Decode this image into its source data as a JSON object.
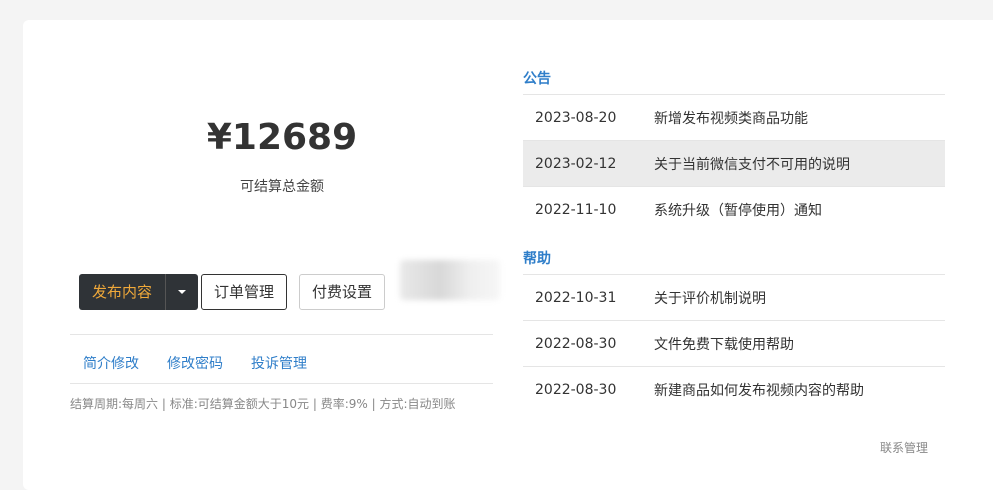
{
  "summary": {
    "amount": "¥12689",
    "amount_label": "可结算总金额"
  },
  "actions": {
    "publish_label": "发布内容",
    "orders_label": "订单管理",
    "pay_settings_label": "付费设置"
  },
  "links": [
    "简介修改",
    "修改密码",
    "投诉管理"
  ],
  "footnote": "结算周期:每周六 | 标准:可结算金额大于10元 | 费率:9% | 方式:自动到账",
  "announcements": {
    "title": "公告",
    "items": [
      {
        "date": "2023-08-20",
        "text": "新增发布视频类商品功能"
      },
      {
        "date": "2023-02-12",
        "text": "关于当前微信支付不可用的说明"
      },
      {
        "date": "2022-11-10",
        "text": "系统升级（暂停使用）通知"
      }
    ]
  },
  "help": {
    "title": "帮助",
    "items": [
      {
        "date": "2022-10-31",
        "text": "关于评价机制说明"
      },
      {
        "date": "2022-08-30",
        "text": "文件免费下载使用帮助"
      },
      {
        "date": "2022-08-30",
        "text": "新建商品如何发布视频内容的帮助"
      }
    ]
  },
  "contact_label": "联系管理",
  "colors": {
    "accent_link": "#2f7ec9",
    "primary_button_bg": "#2f3337",
    "primary_button_text": "#f0a93a"
  }
}
